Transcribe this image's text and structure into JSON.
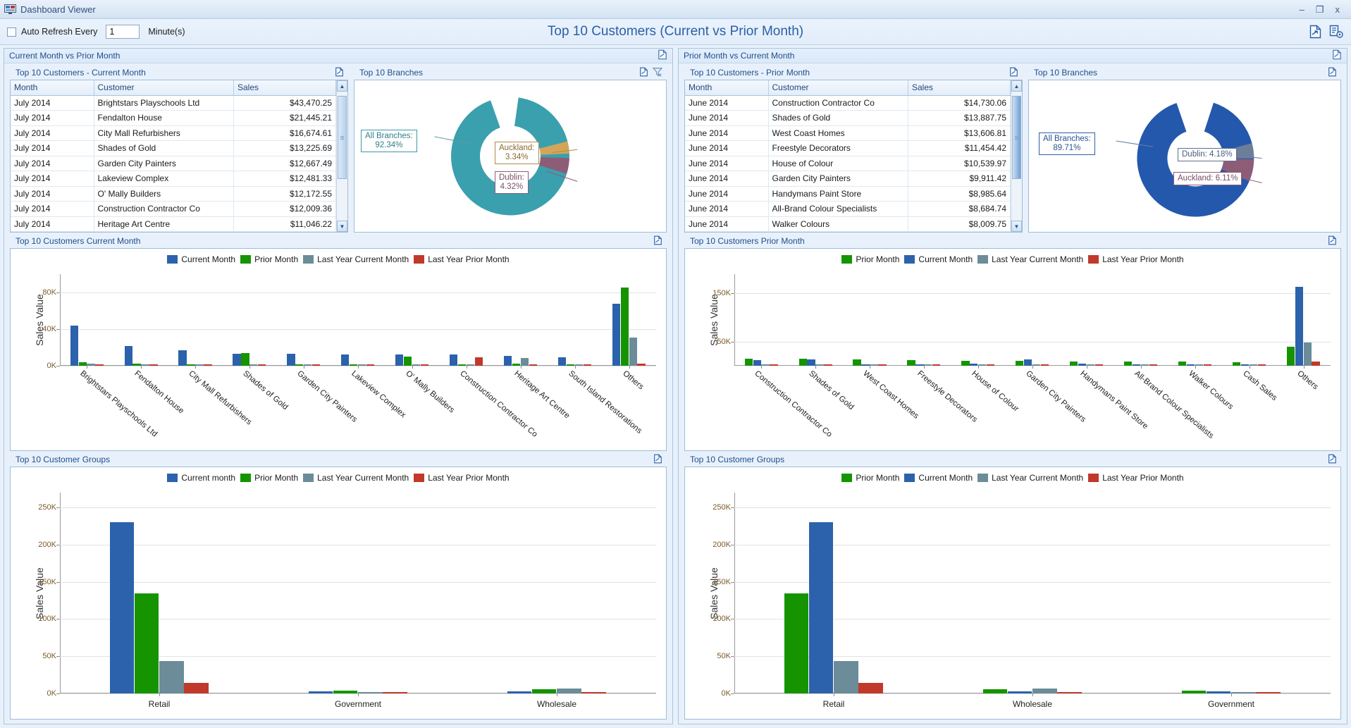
{
  "window": {
    "title": "Dashboard Viewer",
    "icon": "dashboard-window-icon",
    "minimize": "–",
    "maximize": "❐",
    "close": "x"
  },
  "toolbar": {
    "auto_refresh_label": "Auto Refresh Every",
    "auto_refresh_checked": false,
    "interval_value": "1",
    "interval_placeholder": "1",
    "minutes_label": "Minute(s)",
    "dashboard_title": "Top 10 Customers (Current vs Prior Month)",
    "export_icon": "export-document-icon",
    "settings_icon": "document-settings-icon"
  },
  "colors": {
    "current_month": "#2b62ab",
    "prior_month": "#159400",
    "last_year_current_month": "#6b8c98",
    "last_year_prior_month": "#c0392b",
    "donut_teal": "#3aa0ae",
    "donut_tan": "#d4a559",
    "donut_plum": "#8d5d78",
    "donut_blue": "#2358ad",
    "donut_slate": "#6d7e99",
    "title_blue": "#2a5fa8"
  },
  "left_panel": {
    "header": "Current Month vs Prior Month",
    "expand_icon": "expand-panel-icon",
    "table_widget": {
      "header": "Top 10 Customers - Current Month",
      "expand_icon": "expand-panel-icon",
      "columns": [
        "Month",
        "Customer",
        "Sales"
      ],
      "rows": [
        {
          "month": "July 2014",
          "customer": "Brightstars Playschools Ltd",
          "sales": "$43,470.25"
        },
        {
          "month": "July 2014",
          "customer": "Fendalton House",
          "sales": "$21,445.21"
        },
        {
          "month": "July 2014",
          "customer": "City Mall Refurbishers",
          "sales": "$16,674.61"
        },
        {
          "month": "July 2014",
          "customer": "Shades of Gold",
          "sales": "$13,225.69"
        },
        {
          "month": "July 2014",
          "customer": "Garden City Painters",
          "sales": "$12,667.49"
        },
        {
          "month": "July 2014",
          "customer": "Lakeview Complex",
          "sales": "$12,481.33"
        },
        {
          "month": "July 2014",
          "customer": "O' Mally Builders",
          "sales": "$12,172.55"
        },
        {
          "month": "July 2014",
          "customer": "Construction Contractor Co",
          "sales": "$12,009.36"
        },
        {
          "month": "July 2014",
          "customer": "Heritage Art Centre",
          "sales": "$11,046.22"
        }
      ]
    },
    "donut_widget": {
      "header": "Top 10 Branches",
      "expand_icon": "expand-panel-icon",
      "filter_icon": "clear-filter-icon",
      "slices": [
        {
          "label": "All Branches:",
          "value": "92.34%",
          "pct": 92.34,
          "color": "#3aa0ae",
          "style": "teal"
        },
        {
          "label": "Auckland:",
          "value": "3.34%",
          "pct": 3.34,
          "color": "#d4a559",
          "style": "tan"
        },
        {
          "label": "Dublin:",
          "value": "4.32%",
          "pct": 4.32,
          "color": "#8d5d78",
          "style": "plum"
        }
      ]
    },
    "customers_chart": {
      "header": "Top 10 Customers Current Month",
      "expand_icon": "expand-panel-icon"
    },
    "groups_chart": {
      "header": "Top 10 Customer Groups",
      "expand_icon": "expand-panel-icon"
    }
  },
  "right_panel": {
    "header": "Prior Month vs Current Month",
    "expand_icon": "expand-panel-icon",
    "table_widget": {
      "header": "Top 10 Customers - Prior Month",
      "expand_icon": "expand-panel-icon",
      "columns": [
        "Month",
        "Customer",
        "Sales"
      ],
      "rows": [
        {
          "month": "June 2014",
          "customer": "Construction Contractor Co",
          "sales": "$14,730.06"
        },
        {
          "month": "June 2014",
          "customer": "Shades of Gold",
          "sales": "$13,887.75"
        },
        {
          "month": "June 2014",
          "customer": "West Coast Homes",
          "sales": "$13,606.81"
        },
        {
          "month": "June 2014",
          "customer": "Freestyle Decorators",
          "sales": "$11,454.42"
        },
        {
          "month": "June 2014",
          "customer": "House of Colour",
          "sales": "$10,539.97"
        },
        {
          "month": "June 2014",
          "customer": "Garden City Painters",
          "sales": "$9,911.42"
        },
        {
          "month": "June 2014",
          "customer": "Handymans Paint Store",
          "sales": "$8,985.64"
        },
        {
          "month": "June 2014",
          "customer": "All-Brand Colour Specialists",
          "sales": "$8,684.74"
        },
        {
          "month": "June 2014",
          "customer": "Walker Colours",
          "sales": "$8,009.75"
        }
      ]
    },
    "donut_widget": {
      "header": "Top 10 Branches",
      "expand_icon": "expand-panel-icon",
      "slices": [
        {
          "label": "All Branches:",
          "value": "89.71%",
          "pct": 89.71,
          "color": "#2358ad",
          "style": "blue"
        },
        {
          "label": "Dublin: 4.18%",
          "value": "4.18%",
          "pct": 4.18,
          "color": "#6d7e99",
          "style": "slate"
        },
        {
          "label": "Auckland: 6.11%",
          "value": "6.11%",
          "pct": 6.11,
          "color": "#8d5d78",
          "style": "plum"
        }
      ]
    },
    "customers_chart": {
      "header": "Top 10 Customers Prior Month",
      "expand_icon": "expand-panel-icon"
    },
    "groups_chart": {
      "header": "Top 10 Customer Groups",
      "expand_icon": "expand-panel-icon"
    }
  },
  "chart_data": [
    {
      "id": "left-customers",
      "type": "bar",
      "title": "Top 10 Customers Current Month",
      "xlabel": "",
      "ylabel": "Sales Value",
      "ylim": [
        0,
        100000
      ],
      "yticks": [
        0,
        40000,
        80000
      ],
      "ytick_labels": [
        "0K",
        "40K",
        "80K"
      ],
      "grid": true,
      "legend_position": "top",
      "categories": [
        "Brightstars Playschools Ltd",
        "Fendalton House",
        "City Mall Refurbishers",
        "Shades of Gold",
        "Garden City Painters",
        "Lakeview Complex",
        "O' Mally Builders",
        "Construction Contractor Co",
        "Heritage Art Centre",
        "South Island Restorations",
        "Others"
      ],
      "series": [
        {
          "name": "Current Month",
          "color": "#2b62ab",
          "values": [
            43470,
            21445,
            16675,
            13226,
            12667,
            12481,
            12173,
            12009,
            11046,
            9500,
            68000
          ]
        },
        {
          "name": "Prior Month",
          "color": "#159400",
          "values": [
            3600,
            2400,
            900,
            13888,
            1200,
            1500,
            9911,
            1000,
            2400,
            1600,
            85000
          ]
        },
        {
          "name": "Last Year Current Month",
          "color": "#6b8c98",
          "values": [
            2200,
            600,
            500,
            400,
            700,
            600,
            600,
            1500,
            8200,
            700,
            31000
          ]
        },
        {
          "name": "Last Year Prior Month",
          "color": "#c0392b",
          "values": [
            400,
            400,
            400,
            400,
            400,
            400,
            400,
            9500,
            400,
            400,
            2500
          ]
        }
      ]
    },
    {
      "id": "right-customers",
      "type": "bar",
      "title": "Top 10 Customers Prior Month",
      "xlabel": "",
      "ylabel": "Sales Value",
      "ylim": [
        0,
        190000
      ],
      "yticks": [
        50000,
        150000
      ],
      "ytick_labels": [
        "50K",
        "150K"
      ],
      "grid": true,
      "legend_position": "top",
      "categories": [
        "Construction Contractor Co",
        "Shades of Gold",
        "West Coast Homes",
        "Freestyle Decorators",
        "House of Colour",
        "Garden City Painters",
        "Handymans Paint Store",
        "All-Brand Colour Specialists",
        "Walker Colours",
        "Cash Sales",
        "Others"
      ],
      "series": [
        {
          "name": "Prior Month",
          "color": "#159400",
          "values": [
            14730,
            13888,
            13607,
            11454,
            10540,
            9911,
            8986,
            8685,
            8010,
            7500,
            39000
          ]
        },
        {
          "name": "Current Month",
          "color": "#2b62ab",
          "values": [
            12009,
            13226,
            3000,
            3200,
            3800,
            12667,
            3600,
            3400,
            3100,
            3000,
            163000
          ]
        },
        {
          "name": "Last Year Current Month",
          "color": "#6b8c98",
          "values": [
            1500,
            400,
            500,
            600,
            500,
            700,
            500,
            600,
            500,
            600,
            48000
          ]
        },
        {
          "name": "Last Year Prior Month",
          "color": "#c0392b",
          "values": [
            900,
            500,
            400,
            400,
            500,
            400,
            400,
            400,
            400,
            400,
            9000
          ]
        }
      ]
    },
    {
      "id": "left-groups",
      "type": "bar",
      "title": "Top 10 Customer Groups",
      "xlabel": "",
      "ylabel": "Sales Value",
      "ylim": [
        0,
        270000
      ],
      "yticks": [
        0,
        50000,
        100000,
        150000,
        200000,
        250000
      ],
      "ytick_labels": [
        "0K",
        "50K",
        "100K",
        "150K",
        "200K",
        "250K"
      ],
      "grid": true,
      "legend_position": "top",
      "categories": [
        "Retail",
        "Government",
        "Wholesale"
      ],
      "series": [
        {
          "name": "Current month",
          "color": "#2b62ab",
          "values": [
            230000,
            3000,
            2500
          ]
        },
        {
          "name": "Prior Month",
          "color": "#159400",
          "values": [
            135000,
            3500,
            6000
          ]
        },
        {
          "name": "Last Year Current Month",
          "color": "#6b8c98",
          "values": [
            44000,
            2000,
            7000
          ]
        },
        {
          "name": "Last Year Prior Month",
          "color": "#c0392b",
          "values": [
            14000,
            1500,
            1500
          ]
        }
      ]
    },
    {
      "id": "right-groups",
      "type": "bar",
      "title": "Top 10 Customer Groups",
      "xlabel": "",
      "ylabel": "Sales Value",
      "ylim": [
        0,
        270000
      ],
      "yticks": [
        0,
        50000,
        100000,
        150000,
        200000,
        250000
      ],
      "ytick_labels": [
        "0K",
        "50K",
        "100K",
        "150K",
        "200K",
        "250K"
      ],
      "grid": true,
      "legend_position": "top",
      "categories": [
        "Retail",
        "Wholesale",
        "Government"
      ],
      "series": [
        {
          "name": "Prior Month",
          "color": "#159400",
          "values": [
            135000,
            6000,
            3500
          ]
        },
        {
          "name": "Current Month",
          "color": "#2b62ab",
          "values": [
            230000,
            2500,
            3000
          ]
        },
        {
          "name": "Last Year Current Month",
          "color": "#6b8c98",
          "values": [
            44000,
            7000,
            2000
          ]
        },
        {
          "name": "Last Year Prior Month",
          "color": "#c0392b",
          "values": [
            14000,
            1500,
            1500
          ]
        }
      ]
    }
  ]
}
